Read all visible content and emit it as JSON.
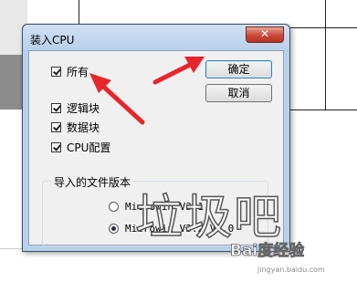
{
  "dialog": {
    "title": "装入CPU",
    "close_glyph": "✕"
  },
  "checkboxes": [
    {
      "label": "所有",
      "checked": true
    },
    {
      "label": "逻辑块",
      "checked": true
    },
    {
      "label": "数据块",
      "checked": true
    },
    {
      "label": "CPU配置",
      "checked": true
    }
  ],
  "buttons": {
    "ok": "确定",
    "cancel": "取消"
  },
  "version_group": {
    "title": "导入的文件版本",
    "options": [
      {
        "label": "Microwin V3.1",
        "selected": false
      },
      {
        "label": "Microwin V3.2 V4.0",
        "selected": true
      }
    ]
  },
  "watermark": {
    "text": "垃圾吧",
    "logo": "Bai度经验",
    "url": "jingyan.baidu.com"
  },
  "colors": {
    "annotation_arrow": "#e8242c",
    "titlebar": "#b9d1ea",
    "close_button": "#c7493a"
  }
}
